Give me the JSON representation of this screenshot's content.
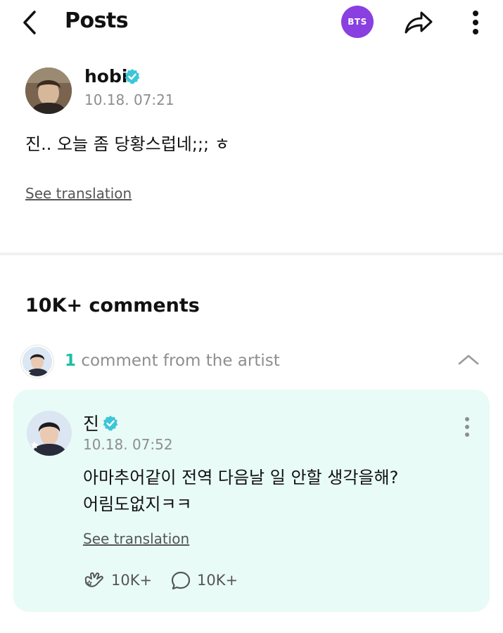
{
  "header": {
    "title": "Posts",
    "community_badge": "BTS",
    "accent_color": "#8a3fe0"
  },
  "post": {
    "author": "hobi",
    "timestamp": "10.18. 07:21",
    "body": "진.. 오늘 좀 당황스럽네;;; ㅎ",
    "see_translation": "See translation"
  },
  "comments": {
    "count_label": "10K+ comments",
    "artist_section": {
      "count": "1",
      "label": "comment from the artist",
      "highlight_color": "#1bbfa7"
    },
    "artist_comment": {
      "author": "진",
      "timestamp": "10.18. 07:52",
      "text_line1": "아마추어같이 전역 다음날 일 안할 생각을해?",
      "text_line2": "어림도없지ㅋㅋ",
      "see_translation": "See translation",
      "likes": "10K+",
      "replies": "10K+",
      "card_color": "#e8fbf6"
    }
  },
  "icons": {
    "back": "chevron-left-icon",
    "share": "share-arrow-icon",
    "more": "more-vertical-icon",
    "verified": "verified-badge-icon",
    "collapse": "chevron-up-icon",
    "like": "like-hand-icon",
    "reply": "comment-bubble-icon"
  }
}
